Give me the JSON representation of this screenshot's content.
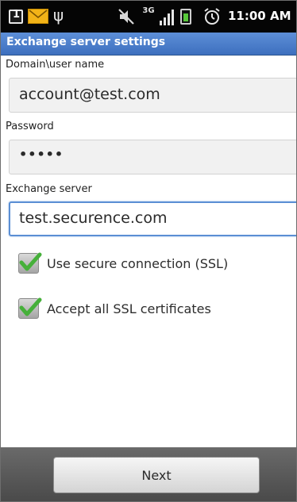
{
  "status_bar": {
    "icons": [
      "sim-1-icon",
      "mail-icon",
      "usb-icon",
      "mute-icon",
      "network-35g-icon",
      "signal-icon",
      "battery-icon",
      "alarm-icon"
    ],
    "network_type": "3G",
    "time": "11:00 AM"
  },
  "title": "Exchange server settings",
  "form": {
    "username": {
      "label": "Domain\\user name",
      "value": "account@test.com"
    },
    "password": {
      "label": "Password",
      "value": "•••••"
    },
    "server": {
      "label": "Exchange server",
      "value": "test.securence.com"
    },
    "use_ssl": {
      "label": "Use secure connection (SSL)",
      "checked": true
    },
    "accept_all_certs": {
      "label": "Accept all SSL certificates",
      "checked": true
    }
  },
  "bottom": {
    "next_label": "Next"
  },
  "colors": {
    "title_bar": "#4a7cc8",
    "checkmark": "#46b03a",
    "focus_border": "#5b8fd4"
  }
}
